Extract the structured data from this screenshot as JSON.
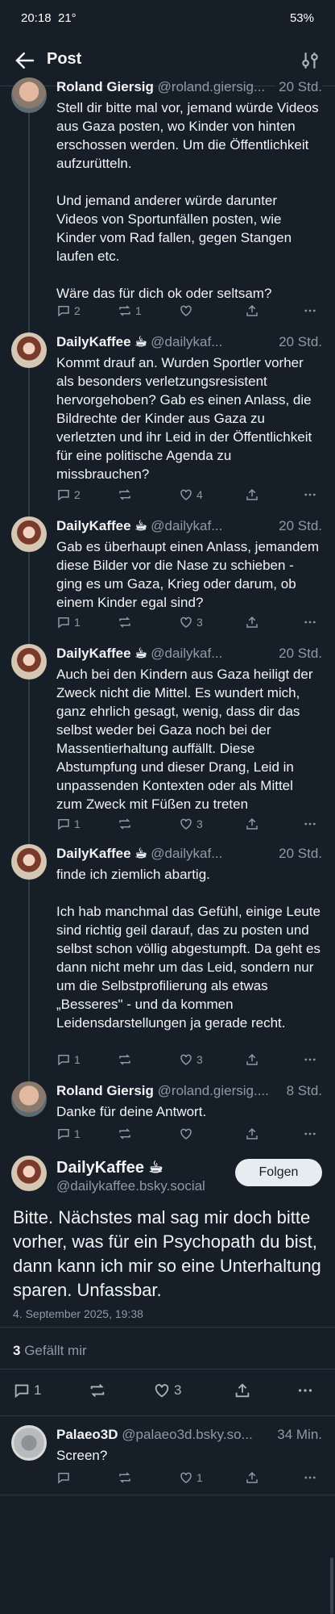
{
  "status_bar": {
    "time": "20:18",
    "temp": "21°",
    "battery": "53%"
  },
  "header": {
    "title": "Post"
  },
  "posts": [
    {
      "name": "Roland Giersig",
      "handle": "@roland.giersig...",
      "time": "20 Std.",
      "text": "Stell dir bitte mal vor, jemand würde Videos aus Gaza posten, wo Kinder von hinten erschossen werden. Um die Öffentlichkeit aufzurütteln.\n\nUnd jemand anderer würde darunter Videos von Sportunfällen posten, wie Kinder vom Rad fallen, gegen Stangen laufen etc.\n\nWäre das für dich ok oder seltsam?",
      "replies": "2",
      "reposts": "1",
      "likes": ""
    },
    {
      "name": "DailyKaffee ☕︎",
      "handle": "@dailykaf...",
      "time": "20 Std.",
      "text": "Kommt drauf an. Wurden Sportler vorher als besonders verletzungsresistent hervorgehoben? Gab es einen Anlass, die Bildrechte der Kinder aus Gaza zu verletzten und ihr Leid in der Öffentlichkeit für eine politische Agenda zu missbrauchen?",
      "replies": "2",
      "reposts": "",
      "likes": "4"
    },
    {
      "name": "DailyKaffee ☕︎",
      "handle": "@dailykaf...",
      "time": "20 Std.",
      "text": "Gab es überhaupt einen Anlass, jemandem diese Bilder vor die Nase zu schieben - ging es um Gaza, Krieg oder darum, ob einem Kinder egal sind?",
      "replies": "1",
      "reposts": "",
      "likes": "3"
    },
    {
      "name": "DailyKaffee ☕︎",
      "handle": "@dailykaf...",
      "time": "20 Std.",
      "text": "Auch bei den Kindern aus Gaza heiligt der Zweck nicht die Mittel. Es wundert mich, ganz ehrlich gesagt, wenig, dass dir das selbst weder bei Gaza noch bei der Massentierhaltung auffällt. Diese Abstumpfung und dieser Drang, Leid in unpassenden Kontexten oder als Mittel zum Zweck mit Füßen zu treten",
      "replies": "1",
      "reposts": "",
      "likes": "3"
    },
    {
      "name": "DailyKaffee ☕︎",
      "handle": "@dailykaf...",
      "time": "20 Std.",
      "text": "finde ich ziemlich abartig.\n\nIch hab manchmal das Gefühl, einige Leute sind richtig geil darauf, das zu posten und selbst schon völlig abgestumpft. Da geht es dann nicht mehr um das Leid, sondern nur um die Selbstprofilierung als etwas „Besseres\" - und da kommen Leidensdarstellungen ja gerade recht.",
      "replies": "1",
      "reposts": "",
      "likes": "3"
    },
    {
      "name": "Roland Giersig",
      "handle": "@roland.giersig....",
      "time": "8 Std.",
      "text": "Danke für deine Antwort.",
      "replies": "1",
      "reposts": "",
      "likes": ""
    }
  ],
  "focus": {
    "name": "DailyKaffee ☕︎",
    "handle": "@dailykaffee.bsky.social",
    "follow_label": "Folgen",
    "text": "Bitte. Nächstes mal sag mir doch bitte vorher, was für ein Psychopath du bist, dann kann ich mir so eine Unterhaltung sparen. Unfassbar.",
    "date": "4. September 2025, 19:38",
    "likes_count": "3",
    "likes_label": "Gefällt mir",
    "replies": "1",
    "likes": "3"
  },
  "reply": {
    "name": "Palaeo3D",
    "handle": "@palaeo3d.bsky.so...",
    "time": "34 Min.",
    "text": "Screen?",
    "likes": "1"
  }
}
